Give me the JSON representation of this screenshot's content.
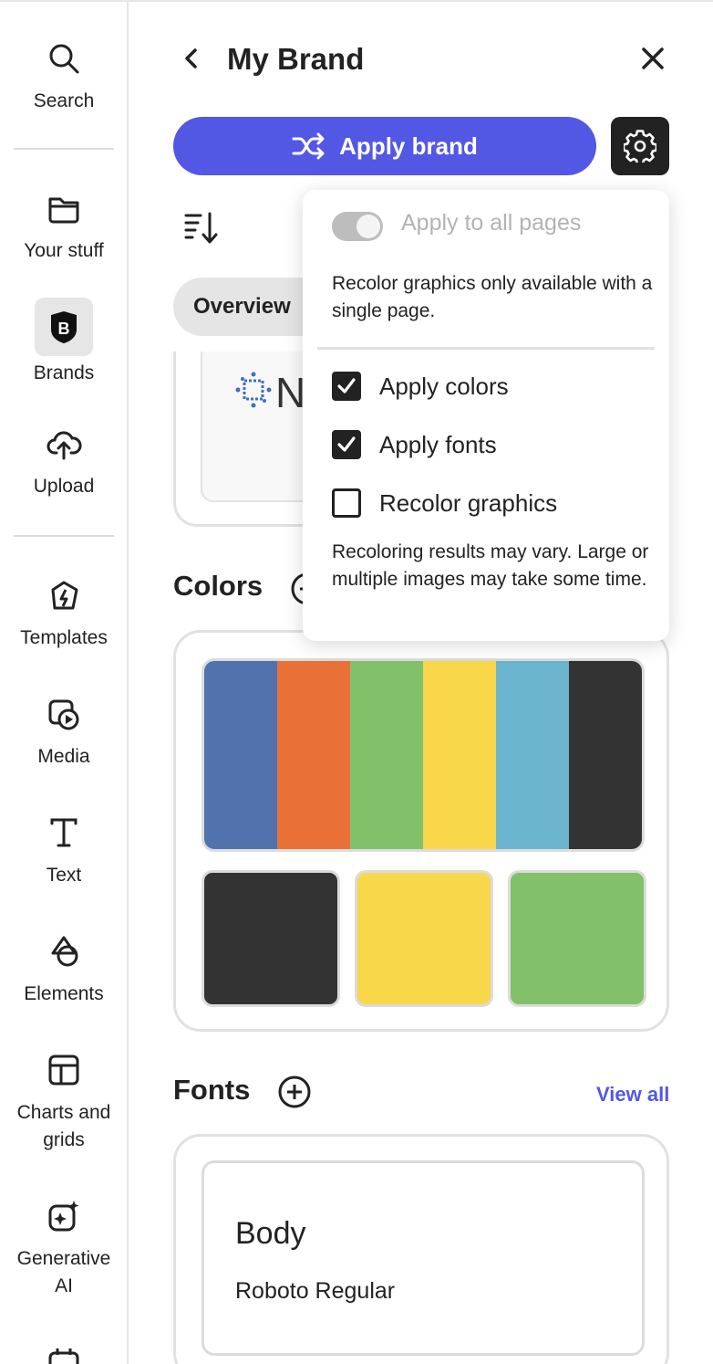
{
  "rail": {
    "items": [
      {
        "label": "Search"
      },
      {
        "label": "Your stuff"
      },
      {
        "label": "Brands"
      },
      {
        "label": "Upload"
      },
      {
        "label": "Templates"
      },
      {
        "label": "Media"
      },
      {
        "label": "Text"
      },
      {
        "label": "Elements"
      },
      {
        "label": "Charts and grids"
      },
      {
        "label": "Generative AI"
      }
    ]
  },
  "panel": {
    "title": "My Brand",
    "apply_label": "Apply brand",
    "tab_overview": "Overview",
    "logo_text": "N",
    "colors_title": "Colors",
    "fonts_title": "Fonts",
    "view_all": "View all",
    "palette": [
      "#5272AE",
      "#E97137",
      "#82C16A",
      "#F9D74A",
      "#6CB5CE",
      "#333333"
    ],
    "swatches": [
      "#333333",
      "#F9D74A",
      "#82C16A"
    ],
    "font_card": {
      "label": "Body",
      "font_name": "Roboto Regular"
    }
  },
  "popover": {
    "toggle_label": "Apply to all pages",
    "toggle_on": true,
    "toggle_disabled": true,
    "note": "Recolor graphics only available with a single page.",
    "options": [
      {
        "label": "Apply colors",
        "checked": true
      },
      {
        "label": "Apply fonts",
        "checked": true
      },
      {
        "label": "Recolor graphics",
        "checked": false
      }
    ],
    "warning": "Recoloring results may vary. Large or multiple images may take some time."
  },
  "accent_color": "#5258E4"
}
